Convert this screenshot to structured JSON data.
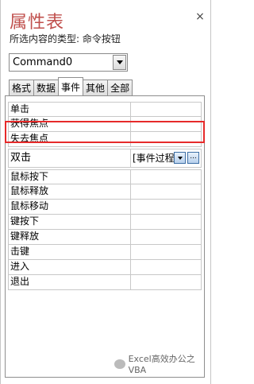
{
  "panel": {
    "title": "属性表",
    "pin_icon": "pin-icon",
    "close_icon": "close-icon",
    "close_glyph": "×",
    "subtitle_prefix": "所选内容的类型: ",
    "subtitle_type": "命令按钮"
  },
  "selector": {
    "value": "Command0"
  },
  "tabs": [
    {
      "label": "格式",
      "active": false
    },
    {
      "label": "数据",
      "active": false
    },
    {
      "label": "事件",
      "active": true
    },
    {
      "label": "其他",
      "active": false
    },
    {
      "label": "全部",
      "active": false
    }
  ],
  "properties": [
    {
      "name": "单击",
      "value": ""
    },
    {
      "name": "获得焦点",
      "value": ""
    },
    {
      "name": "失去焦点",
      "value": ""
    },
    {
      "name": "双击",
      "value": "[事件过程]",
      "selected": true
    },
    {
      "name": "鼠标按下",
      "value": ""
    },
    {
      "name": "鼠标释放",
      "value": ""
    },
    {
      "name": "鼠标移动",
      "value": ""
    },
    {
      "name": "键按下",
      "value": ""
    },
    {
      "name": "键释放",
      "value": ""
    },
    {
      "name": "击键",
      "value": ""
    },
    {
      "name": "进入",
      "value": ""
    },
    {
      "name": "退出",
      "value": ""
    }
  ],
  "build_glyph": "...",
  "watermark": {
    "text": "Excel高效办公之VBA"
  },
  "colors": {
    "title": "#c0504d",
    "highlight": "#e62a2a"
  }
}
